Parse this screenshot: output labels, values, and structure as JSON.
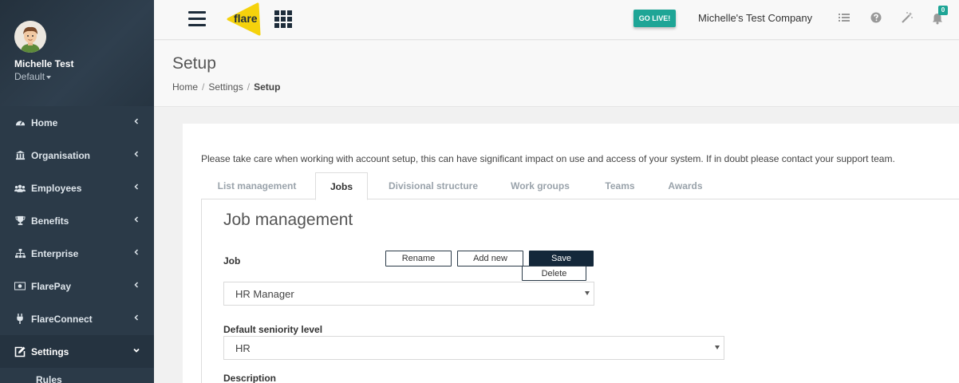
{
  "profile": {
    "name": "Michelle Test",
    "role": "Default"
  },
  "sidebar": {
    "items": [
      {
        "label": "Home",
        "icon": "dashboard-icon"
      },
      {
        "label": "Organisation",
        "icon": "bank-icon"
      },
      {
        "label": "Employees",
        "icon": "users-icon"
      },
      {
        "label": "Benefits",
        "icon": "trophy-icon"
      },
      {
        "label": "Enterprise",
        "icon": "sitemap-icon"
      },
      {
        "label": "FlarePay",
        "icon": "money-icon"
      },
      {
        "label": "FlareConnect",
        "icon": "plug-icon"
      },
      {
        "label": "Settings",
        "icon": "edit-icon"
      }
    ],
    "subitem": "Rules"
  },
  "topbar": {
    "logo_text": "flare",
    "golive_label": "GO LIVE!",
    "company": "Michelle's Test Company",
    "notification_count": "0"
  },
  "page": {
    "title": "Setup",
    "breadcrumb": [
      "Home",
      "Settings",
      "Setup"
    ]
  },
  "notice": "Please take care when working with account setup, this can have significant impact on use and access of your system. If in doubt please contact your support team.",
  "tabs": [
    "List management",
    "Jobs",
    "Divisional structure",
    "Work groups",
    "Teams",
    "Awards"
  ],
  "job_management": {
    "title": "Job management",
    "job_label": "Job",
    "buttons": {
      "rename": "Rename",
      "add_new": "Add new",
      "save": "Save",
      "delete": "Delete"
    },
    "job_value": "HR Manager",
    "seniority_label": "Default seniority level",
    "seniority_value": "HR",
    "description_label": "Description"
  },
  "colors": {
    "sidebar": "#2b3a48",
    "accent": "#1ea596",
    "logo": "#f5d20c",
    "primary_button": "#14283a"
  }
}
